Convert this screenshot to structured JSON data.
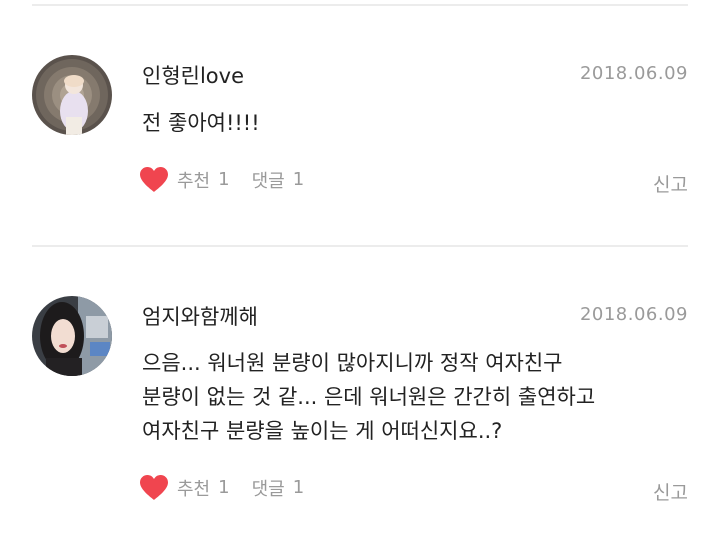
{
  "comments": [
    {
      "author": "인형린love",
      "date": "2018.06.09",
      "body": [
        "전 좋아여!!!!"
      ],
      "like_label": "추천",
      "like_count": "1",
      "reply_label": "댓글",
      "reply_count": "1",
      "report_label": "신고",
      "avatar_icon": "user-photo-avatar"
    },
    {
      "author": "엄지와함께해",
      "date": "2018.06.09",
      "body": [
        "으음... 워너원 분량이 많아지니까 정작 여자친구",
        "분량이 없는 것 같... 은데 워너원은 간간히 출연하고",
        "여자친구 분량을 높이는 게 어떠신지요..?"
      ],
      "like_label": "추천",
      "like_count": "1",
      "reply_label": "댓글",
      "reply_count": "1",
      "report_label": "신고",
      "avatar_icon": "user-photo-avatar"
    }
  ],
  "colors": {
    "heart": "#f0454f",
    "meta_text": "#9a9a9a",
    "divider": "#ececec"
  },
  "icons": {
    "like": "heart-icon"
  }
}
